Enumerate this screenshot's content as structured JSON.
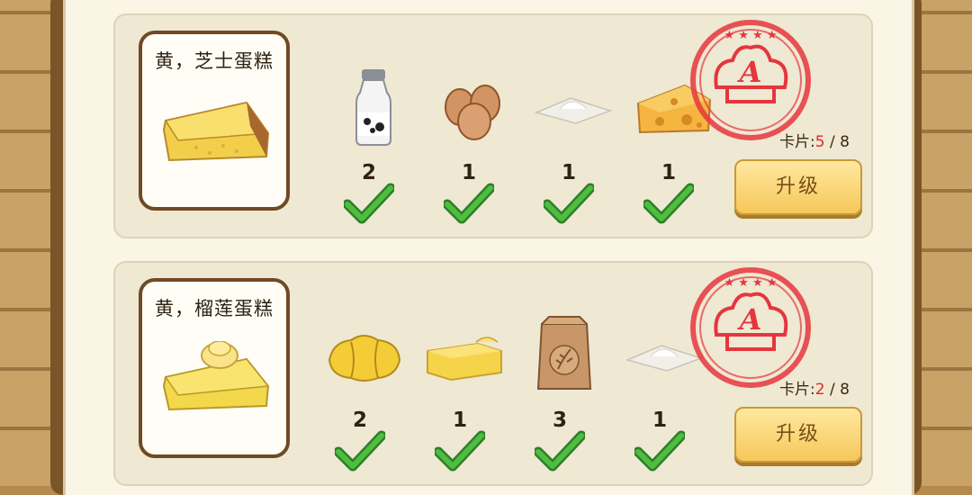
{
  "cards": [
    {
      "name": "黄，芝士蛋糕",
      "ingredients": [
        {
          "icon": "milk-bottle-icon",
          "count": "2"
        },
        {
          "icon": "eggs-icon",
          "count": "1"
        },
        {
          "icon": "flour-pile-icon",
          "count": "1"
        },
        {
          "icon": "cheese-icon",
          "count": "1"
        }
      ],
      "cards_label": "卡片:",
      "cards_current": "5",
      "cards_sep": " / ",
      "cards_total": "8",
      "upgrade_label": "升级"
    },
    {
      "name": "黄，榴莲蛋糕",
      "ingredients": [
        {
          "icon": "durian-icon",
          "count": "2"
        },
        {
          "icon": "butter-icon",
          "count": "1"
        },
        {
          "icon": "flour-bag-icon",
          "count": "3"
        },
        {
          "icon": "flour-pile-icon",
          "count": "1"
        }
      ],
      "cards_label": "卡片:",
      "cards_current": "2",
      "cards_sep": " / ",
      "cards_total": "8",
      "upgrade_label": "升级"
    }
  ],
  "colors": {
    "stamp_red": "#e5363d",
    "check_green": "#3aa335",
    "button_gold": "#f6c75a"
  }
}
